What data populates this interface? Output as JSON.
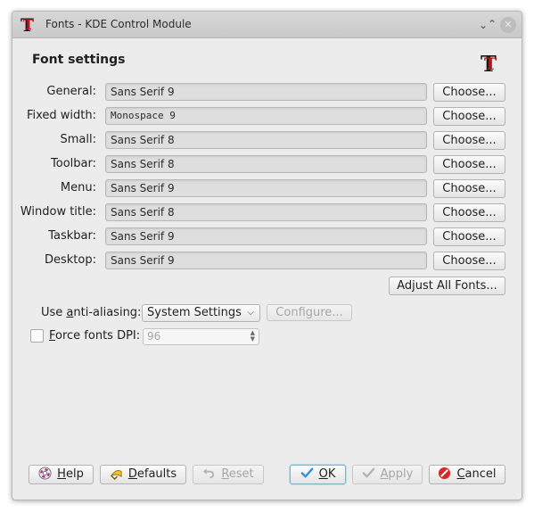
{
  "window": {
    "title": "Fonts - KDE Control Module",
    "minimize_glyph": "⌄",
    "maximize_glyph": "⌃",
    "close_glyph": "✕"
  },
  "heading": "Font settings",
  "rows": [
    {
      "label": "General:",
      "value": "Sans Serif 9",
      "button": "Choose..."
    },
    {
      "label": "Fixed width:",
      "value": "Monospace 9",
      "button": "Choose..."
    },
    {
      "label": "Small:",
      "value": "Sans Serif 8",
      "button": "Choose..."
    },
    {
      "label": "Toolbar:",
      "value": "Sans Serif 8",
      "button": "Choose..."
    },
    {
      "label": "Menu:",
      "value": "Sans Serif 9",
      "button": "Choose..."
    },
    {
      "label": "Window title:",
      "value": "Sans Serif 8",
      "button": "Choose..."
    },
    {
      "label": "Taskbar:",
      "value": "Sans Serif 9",
      "button": "Choose..."
    },
    {
      "label": "Desktop:",
      "value": "Sans Serif 9",
      "button": "Choose..."
    }
  ],
  "adjust_all": "Adjust All Fonts...",
  "antialias": {
    "label_before": "Use ",
    "label_mnemonic": "a",
    "label_after": "nti-aliasing:",
    "selected": "System Settings",
    "configure": "Configure..."
  },
  "dpi": {
    "label_mnemonic": "F",
    "label_after": "orce fonts DPI:",
    "value": "96",
    "checked": false
  },
  "buttons": {
    "help": {
      "mnemonic": "H",
      "rest": "elp"
    },
    "defaults": {
      "mnemonic": "D",
      "rest": "efaults"
    },
    "reset": {
      "mnemonic": "R",
      "rest": "eset"
    },
    "ok": {
      "mnemonic": "O",
      "rest": "K"
    },
    "apply": {
      "mnemonic": "A",
      "rest": "pply"
    },
    "cancel": {
      "mnemonic": "C",
      "rest": "ancel"
    }
  },
  "colors": {
    "accent": "#7fb4c9",
    "logo_red": "#c0141b",
    "cancel_red": "#d42a2a",
    "ok_blue": "#3a8fd0"
  }
}
